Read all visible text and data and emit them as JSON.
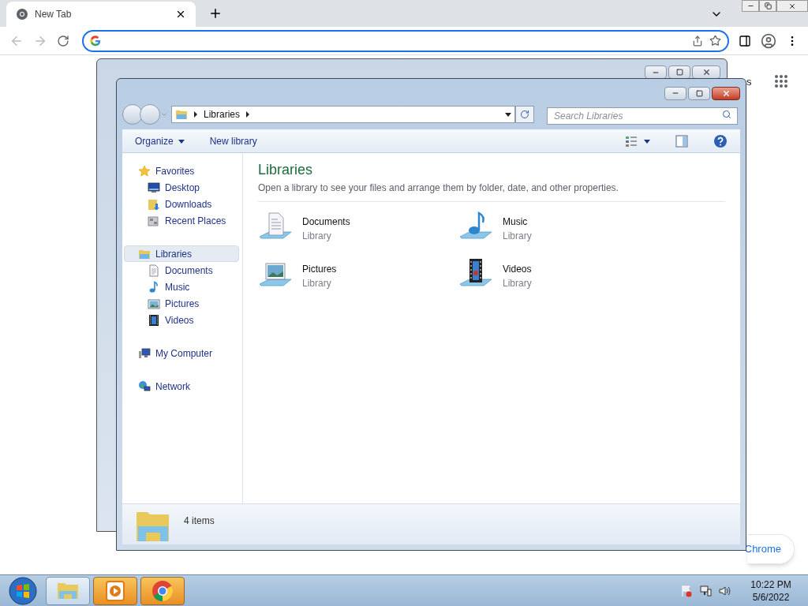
{
  "browser": {
    "tabs": [
      {
        "title": "New Tab",
        "selected": true
      }
    ],
    "partial_link": "s",
    "customize_button": "Chrome"
  },
  "explorer": {
    "breadcrumb": [
      "Libraries"
    ],
    "search": {
      "placeholder": "Search Libraries"
    },
    "toolbar": [
      {
        "label": "Organize",
        "dropdown": true
      },
      {
        "label": "New library",
        "dropdown": false
      }
    ],
    "nav": [
      {
        "label": "Favorites",
        "kind": "star",
        "selected": false,
        "children": [
          {
            "label": "Desktop",
            "kind": "desktop",
            "selected": false
          },
          {
            "label": "Downloads",
            "kind": "downloads",
            "selected": false
          },
          {
            "label": "Recent Places",
            "kind": "recent",
            "selected": false
          }
        ]
      },
      {
        "label": "Libraries",
        "kind": "libraries",
        "selected": true,
        "children": [
          {
            "label": "Documents",
            "kind": "documents",
            "selected": false
          },
          {
            "label": "Music",
            "kind": "music",
            "selected": false
          },
          {
            "label": "Pictures",
            "kind": "pictures",
            "selected": false
          },
          {
            "label": "Videos",
            "kind": "videos",
            "selected": false
          }
        ]
      },
      {
        "label": "My Computer",
        "kind": "computer",
        "selected": false
      },
      {
        "label": "Network",
        "kind": "network",
        "selected": false
      }
    ],
    "heading": "Libraries",
    "description": "Open a library to see your files and arrange them by folder, date, and other properties.",
    "items": [
      {
        "name": "Documents",
        "type": "Library",
        "kind": "documents"
      },
      {
        "name": "Music",
        "type": "Library",
        "kind": "music"
      },
      {
        "name": "Pictures",
        "type": "Library",
        "kind": "pictures"
      },
      {
        "name": "Videos",
        "type": "Library",
        "kind": "videos"
      }
    ],
    "status": "4 items"
  },
  "taskbar": {
    "apps": [
      {
        "kind": "explorer",
        "selected": true
      },
      {
        "kind": "media",
        "selected": false
      },
      {
        "kind": "chrome",
        "selected": false
      }
    ],
    "time": "10:22 PM",
    "date": "5/6/2022"
  }
}
